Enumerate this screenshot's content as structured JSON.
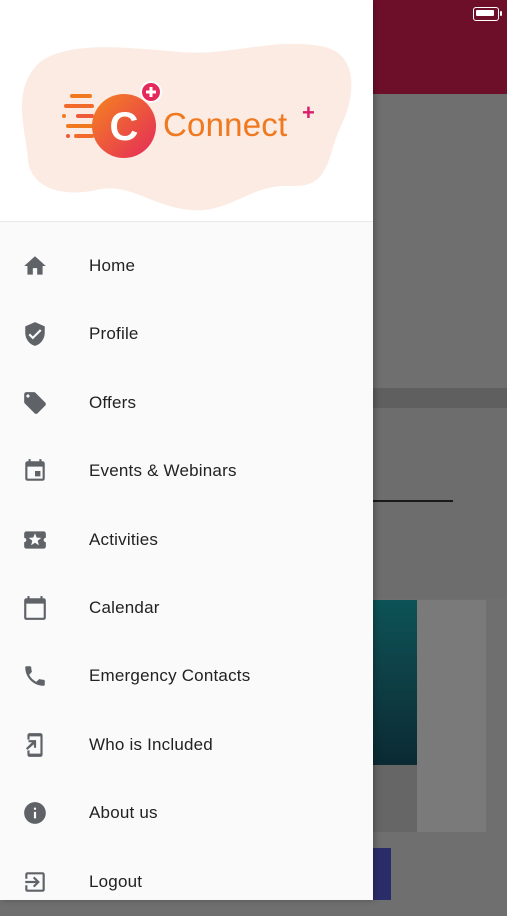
{
  "status_bar": {
    "battery": "full"
  },
  "drawer": {
    "logo": {
      "text": "Connect",
      "plus": "+"
    },
    "items": [
      {
        "label": "Home",
        "icon": "home-icon"
      },
      {
        "label": "Profile",
        "icon": "shield-check-icon"
      },
      {
        "label": "Offers",
        "icon": "tag-icon"
      },
      {
        "label": "Events & Webinars",
        "icon": "event-calendar-icon"
      },
      {
        "label": "Activities",
        "icon": "ticket-star-icon"
      },
      {
        "label": "Calendar",
        "icon": "calendar-icon"
      },
      {
        "label": "Emergency Contacts",
        "icon": "phone-icon"
      },
      {
        "label": "Who is Included",
        "icon": "mobile-share-icon"
      },
      {
        "label": "About us",
        "icon": "info-icon"
      },
      {
        "label": "Logout",
        "icon": "logout-icon"
      }
    ]
  },
  "colors": {
    "accent_orange": "#f0791f",
    "accent_pink": "#d91b6b",
    "header_bg": "#6e0f2a",
    "icon_gray": "#5f6368"
  }
}
